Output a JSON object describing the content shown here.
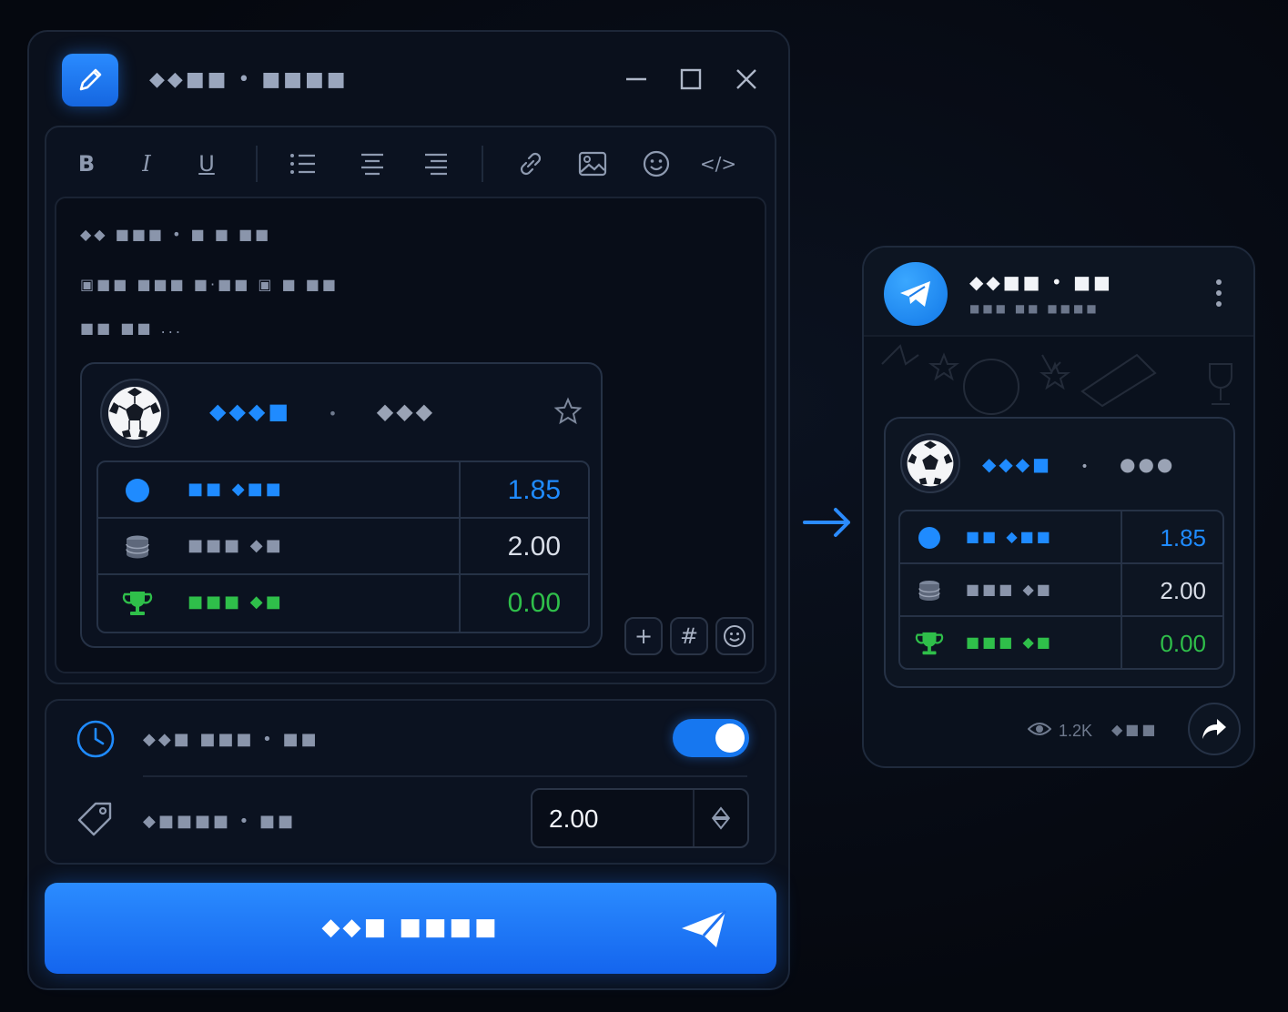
{
  "window": {
    "title": "◆◆■■ • ■■■■",
    "minimize": "minimize",
    "maximize": "maximize",
    "close": "close"
  },
  "toolbar": {
    "bold": "B",
    "italic": "I",
    "underline": "U",
    "bullet_list": "bullet-list",
    "align_center": "align-center",
    "align_right": "align-right",
    "link": "link",
    "image": "image",
    "emoji": "emoji",
    "code": "</>"
  },
  "editor": {
    "lines": [
      "◆◆ ■■■ • ■ ■ ■■",
      "▣■■ ■■■ ■·■■ ▣ ■ ■■",
      "■■ ■■ ..."
    ]
  },
  "card": {
    "title_a": "◆◆◆■",
    "title_sep": "•",
    "title_b": "◆◆◆",
    "rows": [
      {
        "label": "■■ ◆■■",
        "value": "1.85",
        "color": "#1f8bff",
        "icon": "circle-icon"
      },
      {
        "label": "■■■ ◆■",
        "value": "2.00",
        "color": "#d9dee8",
        "icon": "coins-icon"
      },
      {
        "label": "■■■ ◆■",
        "value": "0.00",
        "color": "#2fbf4a",
        "icon": "trophy-icon"
      }
    ]
  },
  "mini": {
    "add": "+",
    "hash": "#",
    "emoji": "emoji"
  },
  "settings": {
    "schedule_label": "◆◆■ ■■■ • ■■",
    "schedule_enabled": true,
    "stake_label": "◆■■■■ • ■■",
    "stake_value": "2.00"
  },
  "send": {
    "label": "◆◆■ ■■■■"
  },
  "preview": {
    "channel_name": "◆◆■■ • ■■",
    "channel_sub": "■■■ ■■ ■■■■",
    "title_a": "◆◆◆■",
    "title_sep": "•",
    "title_b": "●●●",
    "rows": [
      {
        "label": "■■ ◆■■",
        "value": "1.85",
        "color": "#1f8bff",
        "icon": "circle-icon"
      },
      {
        "label": "■■■ ◆■",
        "value": "2.00",
        "color": "#d9dee8",
        "icon": "coins-icon"
      },
      {
        "label": "■■■ ◆■",
        "value": "0.00",
        "color": "#2fbf4a",
        "icon": "trophy-icon"
      }
    ],
    "views": "1.2K",
    "time": "◆■■"
  },
  "colors": {
    "accent": "#1f8bff",
    "success": "#2fbf4a",
    "background": "#05080f"
  }
}
